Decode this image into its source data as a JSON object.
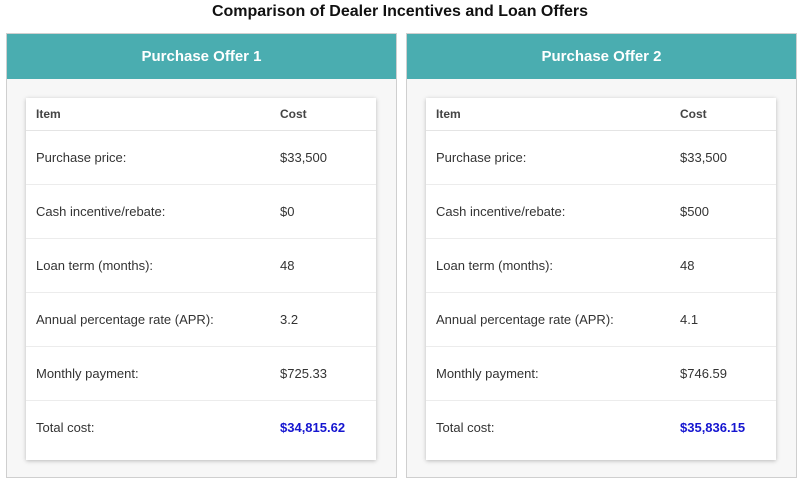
{
  "page": {
    "title": "Comparison of Dealer Incentives and Loan Offers"
  },
  "colors": {
    "header_bg": "#4aadb0",
    "total_text": "#1515d0"
  },
  "offers": [
    {
      "header": "Purchase Offer 1",
      "columns": {
        "item": "Item",
        "cost": "Cost"
      },
      "rows": [
        {
          "item": "Purchase price:",
          "cost": "$33,500"
        },
        {
          "item": "Cash incentive/rebate:",
          "cost": "$0"
        },
        {
          "item": "Loan term (months):",
          "cost": "48"
        },
        {
          "item": "Annual percentage rate (APR):",
          "cost": "3.2"
        },
        {
          "item": "Monthly payment:",
          "cost": "$725.33"
        },
        {
          "item": "Total cost:",
          "cost": "$34,815.62"
        }
      ]
    },
    {
      "header": "Purchase Offer 2",
      "columns": {
        "item": "Item",
        "cost": "Cost"
      },
      "rows": [
        {
          "item": "Purchase price:",
          "cost": "$33,500"
        },
        {
          "item": "Cash incentive/rebate:",
          "cost": "$500"
        },
        {
          "item": "Loan term (months):",
          "cost": "48"
        },
        {
          "item": "Annual percentage rate (APR):",
          "cost": "4.1"
        },
        {
          "item": "Monthly payment:",
          "cost": "$746.59"
        },
        {
          "item": "Total cost:",
          "cost": "$35,836.15"
        }
      ]
    }
  ]
}
